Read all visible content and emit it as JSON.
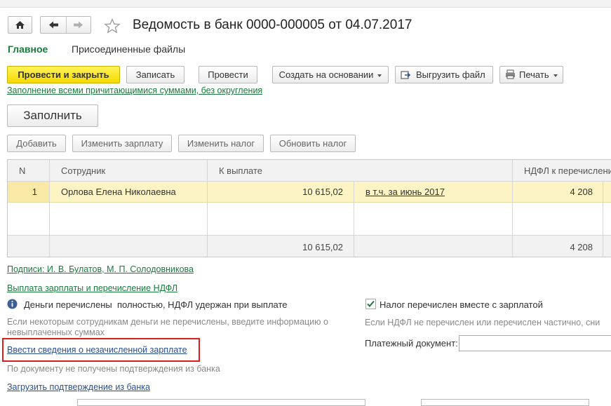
{
  "window": {
    "title": "Ведомость в банк 0000-000005 от 04.07.2017"
  },
  "tabs": [
    {
      "label": "Главное"
    },
    {
      "label": "Присоединенные файлы"
    }
  ],
  "toolbar": {
    "post_close": "Провести и закрыть",
    "write": "Записать",
    "post": "Провести",
    "create_based": "Создать на основании",
    "export_file": "Выгрузить файл",
    "print": "Печать"
  },
  "fill": {
    "hint_link": "Заполнение всеми причитающимися суммами, без округления",
    "button": "Заполнить"
  },
  "table_toolbar": {
    "add": "Добавить",
    "change_salary": "Изменить зарплату",
    "change_tax": "Изменить налог",
    "update_tax": "Обновить налог"
  },
  "table": {
    "headers": [
      "N",
      "Сотрудник",
      "К выплате",
      "",
      "НДФЛ к перечислению"
    ],
    "rows": [
      {
        "n": "1",
        "employee": "Орлова Елена Николаевна",
        "amount": "10 615,02",
        "incl": "в т.ч. за июнь 2017",
        "ndfl": "4 208"
      }
    ],
    "footer": {
      "amount": "10 615,02",
      "ndfl": "4 208"
    }
  },
  "signatures_link": "Подписи: И. В. Булатов, М. П. Солодовникова",
  "payment_section": {
    "header_link": "Выплата зарплаты и перечисление НДФЛ",
    "status_text": "Деньги перечислены  полностью, НДФЛ удержан при выплате",
    "tax_checkbox_label": "Налог перечислен вместе с зарплатой",
    "tax_checked": true,
    "hint_left": "Если некоторым сотрудникам деньги не перечислены, введите информацию о невыплаченных суммах",
    "hint_right": "Если НДФЛ не перечислен или перечислен частично, сни",
    "unpaid_link": "Ввести сведения о незачисленной зарплате",
    "payment_doc_label": "Платежный документ:",
    "payment_doc_value": "",
    "no_confirmations": "По документу не получены подтверждения из банка",
    "load_confirmation_link": "Загрузить подтверждение из банка"
  },
  "colors": {
    "accent_green": "#1a7a3c",
    "primary_yellow": "#f5d900",
    "selected_row": "#fdf4c5",
    "highlight_red": "#d9201f"
  }
}
